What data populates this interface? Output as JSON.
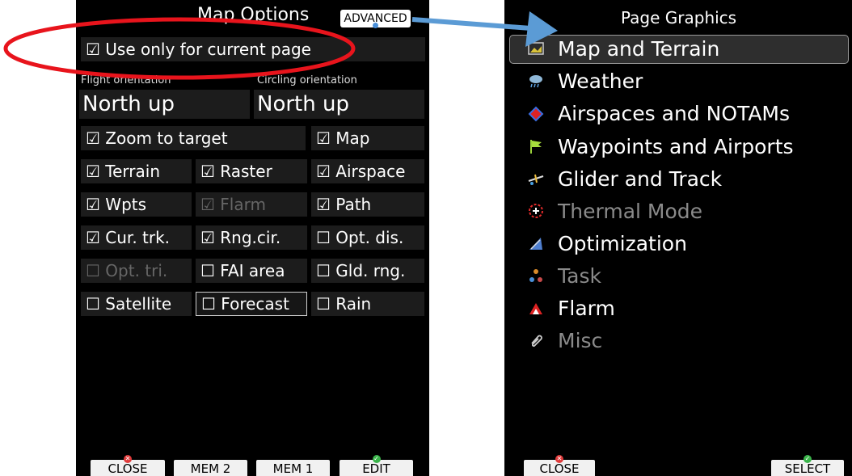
{
  "left": {
    "title": "Map Options",
    "advanced_label": "ADVANCED",
    "use_current_page": "☑ Use only for current page",
    "flight_orientation_label": "Flight orientation",
    "circling_orientation_label": "Circling orientation",
    "flight_orientation_value": "North up",
    "circling_orientation_value": "North up",
    "options": {
      "zoom_to_target": "☑ Zoom to target",
      "map": "☑ Map",
      "terrain": "☑ Terrain",
      "raster": "☑ Raster",
      "airspace": "☑ Airspace",
      "wpts": "☑ Wpts",
      "flarm": "☑ Flarm",
      "path": "☑ Path",
      "cur_trk": "☑ Cur. trk.",
      "rng_cir": "☑ Rng.cir.",
      "opt_dis": "☐ Opt. dis.",
      "opt_tri": "☐ Opt. tri.",
      "fai_area": "☐ FAI area",
      "gld_rng": "☐ Gld. rng.",
      "satellite": "☐ Satellite",
      "forecast": "☐ Forecast",
      "rain": "☐ Rain"
    },
    "softkeys": {
      "close": "CLOSE",
      "mem2": "MEM 2",
      "mem1": "MEM 1",
      "edit": "EDIT"
    }
  },
  "right": {
    "title": "Page Graphics",
    "menu": [
      {
        "label": "Map and Terrain",
        "icon": "map-terrain-icon",
        "selected": true,
        "disabled": false
      },
      {
        "label": "Weather",
        "icon": "weather-icon",
        "disabled": false
      },
      {
        "label": "Airspaces and NOTAMs",
        "icon": "airspace-icon",
        "disabled": false
      },
      {
        "label": "Waypoints and Airports",
        "icon": "waypoint-flag-icon",
        "disabled": false
      },
      {
        "label": "Glider and Track",
        "icon": "glider-icon",
        "disabled": false
      },
      {
        "label": "Thermal Mode",
        "icon": "thermal-icon",
        "disabled": true
      },
      {
        "label": "Optimization",
        "icon": "optimization-icon",
        "disabled": false
      },
      {
        "label": "Task",
        "icon": "task-icon",
        "disabled": true
      },
      {
        "label": "Flarm",
        "icon": "flarm-icon",
        "disabled": false
      },
      {
        "label": "Misc",
        "icon": "paperclip-icon",
        "disabled": true
      }
    ],
    "softkeys": {
      "close": "CLOSE",
      "select": "SELECT"
    }
  },
  "colors": {
    "annotation_oval": "#e8141c",
    "annotation_arrow": "#5b9bd5"
  }
}
